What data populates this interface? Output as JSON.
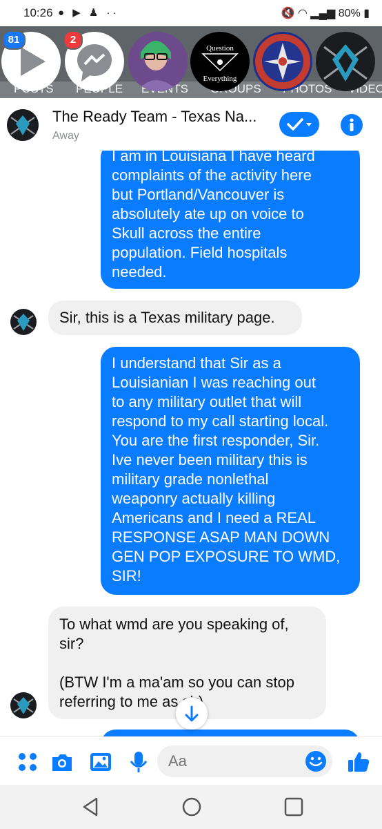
{
  "status_bar": {
    "time": "10:26",
    "battery": "80%"
  },
  "chat_heads": {
    "videos_badge": "81",
    "messenger_badge": "2",
    "question_line1": "Question",
    "question_line2": "Everything",
    "fb_tabs": [
      "POSTS",
      "PEOPLE",
      "EVENTS",
      "GROUPS",
      "PHOTOS",
      "VIDEOS"
    ]
  },
  "header": {
    "title": "The Ready Team - Texas Na...",
    "status": "Away"
  },
  "messages": [
    {
      "dir": "out",
      "text": "I am in Louisiana I have heard\ncomplaints of the activity here\nbut Portland/Vancouver is\nabsolutely ate up on voice to\nSkull across the entire\npopulation. Field hospitals\nneeded."
    },
    {
      "dir": "in",
      "text": "Sir, this is a Texas military page."
    },
    {
      "dir": "out",
      "text": "I understand that Sir as a\nLouisianian I was reaching out\nto any military outlet that will\nrespond to my call starting local.\nYou are the first responder, Sir.\nIve never been military this is\nmilitary grade nonlethal\nweaponry actually killing\nAmericans and I need a REAL\nRESPONSE ASAP MAN DOWN\nGEN POP EXPOSURE TO WMD,\nSIR!"
    },
    {
      "dir": "in",
      "text": "To what wmd are you speaking of,\nsir?\n\n(BTW I'm a ma'am so you can stop\nreferring to me as sir)"
    }
  ],
  "composer": {
    "placeholder": "Aa"
  },
  "colors": {
    "messenger_blue": "#0a7cff",
    "incoming_bg": "#f0f0f0",
    "badge_red": "#f0393d"
  }
}
